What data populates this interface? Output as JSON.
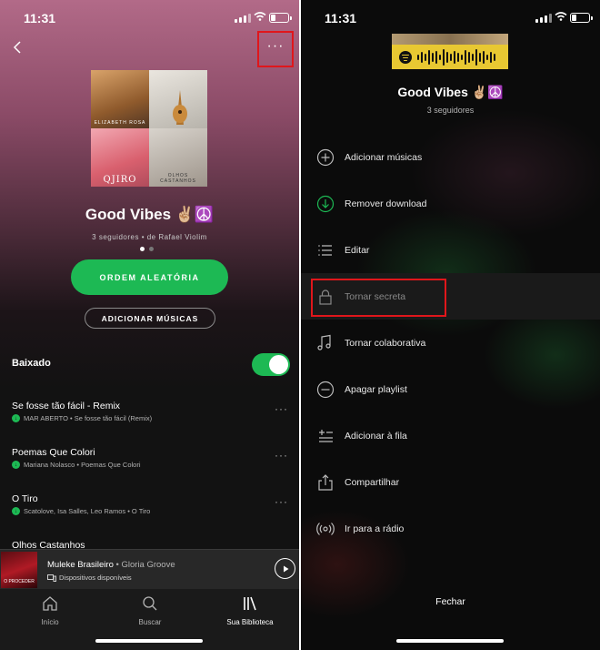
{
  "left": {
    "status": {
      "time": "11:31"
    },
    "more_label": "···",
    "cover_tags": [
      "ELIZABETH ROSA",
      "",
      "QJIRO",
      "OLHOS CASTANHOS"
    ],
    "playlist": {
      "title": "Good Vibes ✌🏼☮️",
      "subtitle": "3 seguidores • de Rafael Violim"
    },
    "shuffle_label": "ORDEM ALEATÓRIA",
    "add_songs_label": "ADICIONAR MÚSICAS",
    "downloaded_label": "Baixado",
    "downloaded_on": true,
    "tracks": [
      {
        "title": "Se fosse tão fácil - Remix",
        "meta": "MAR ABERTO • Se fosse tão fácil (Remix)"
      },
      {
        "title": "Poemas Que Colori",
        "meta": "Mariana Nolasco • Poemas Que Colori"
      },
      {
        "title": "O Tiro",
        "meta": "Scatolove, Isa Salles, Leo Ramos • O Tiro"
      },
      {
        "title": "Olhos Castanhos",
        "meta": ""
      }
    ],
    "now_playing": {
      "art_label": "O PROCEDER",
      "title": "Muleke Brasileiro",
      "artist": " • Gloria Groove",
      "device": "Dispositivos disponíveis"
    },
    "tabs": [
      {
        "label": "Início",
        "icon": "home-icon"
      },
      {
        "label": "Buscar",
        "icon": "search-icon"
      },
      {
        "label": "Sua Biblioteca",
        "icon": "library-icon"
      }
    ]
  },
  "right": {
    "status": {
      "time": "11:31"
    },
    "playlist": {
      "title": "Good Vibes ✌🏼☮️",
      "subtitle": "3 seguidores"
    },
    "menu": [
      {
        "label": "Adicionar músicas",
        "icon": "plus-circle-icon"
      },
      {
        "label": "Remover download",
        "icon": "download-circle-icon"
      },
      {
        "label": "Editar",
        "icon": "edit-list-icon"
      },
      {
        "label": "Tornar secreta",
        "icon": "lock-icon"
      },
      {
        "label": "Tornar colaborativa",
        "icon": "collaborative-music-icon"
      },
      {
        "label": "Apagar playlist",
        "icon": "minus-circle-icon"
      },
      {
        "label": "Adicionar à fila",
        "icon": "add-to-queue-icon"
      },
      {
        "label": "Compartilhar",
        "icon": "share-icon"
      },
      {
        "label": "Ir para a rádio",
        "icon": "radio-icon"
      }
    ],
    "close_label": "Fechar"
  },
  "colors": {
    "accent": "#1db954",
    "highlight": "#e0161b",
    "background": "#121212"
  }
}
